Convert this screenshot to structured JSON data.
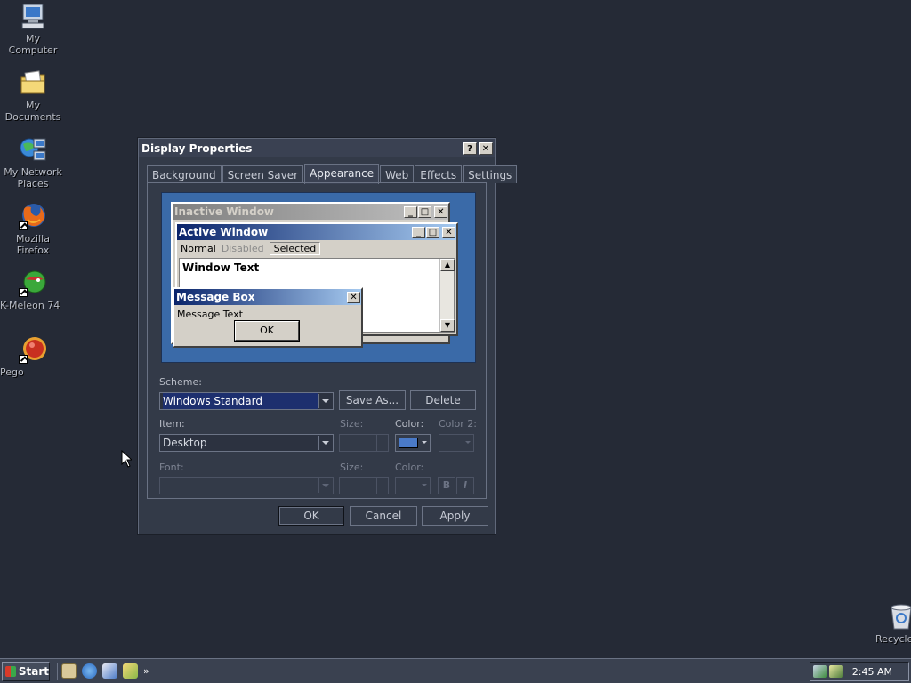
{
  "desktop": {
    "icons": [
      {
        "label": "My Computer"
      },
      {
        "label": "My Documents"
      },
      {
        "label": "My Network Places"
      },
      {
        "label": "Mozilla Firefox"
      },
      {
        "label": "K-Meleon 74"
      },
      {
        "label": "Pego"
      },
      {
        "label": "Recycle"
      }
    ]
  },
  "dialog": {
    "title": "Display Properties",
    "help_glyph": "?",
    "close_glyph": "✕",
    "tabs": [
      {
        "label": "Background"
      },
      {
        "label": "Screen Saver"
      },
      {
        "label": "Appearance"
      },
      {
        "label": "Web"
      },
      {
        "label": "Effects"
      },
      {
        "label": "Settings"
      }
    ],
    "active_tab": "Appearance",
    "preview": {
      "inactive_title": "Inactive Window",
      "active_title": "Active Window",
      "menu": {
        "normal": "Normal",
        "disabled": "Disabled",
        "selected": "Selected"
      },
      "window_text": "Window Text",
      "msgbox_title": "Message Box",
      "msgbox_text": "Message Text",
      "msgbox_ok": "OK"
    },
    "scheme": {
      "label": "Scheme:",
      "value": "Windows Standard",
      "save_as": "Save As...",
      "delete": "Delete"
    },
    "item": {
      "label": "Item:",
      "value": "Desktop",
      "size_label": "Size:",
      "color_label": "Color:",
      "color2_label": "Color 2:",
      "color_value": "#4a7ac8"
    },
    "font": {
      "label": "Font:",
      "size_label": "Size:",
      "color_label": "Color:",
      "bold": "B",
      "italic": "I"
    },
    "buttons": {
      "ok": "OK",
      "cancel": "Cancel",
      "apply": "Apply"
    }
  },
  "taskbar": {
    "start_label": "Start",
    "chevron": "»",
    "clock": "2:45 AM"
  }
}
